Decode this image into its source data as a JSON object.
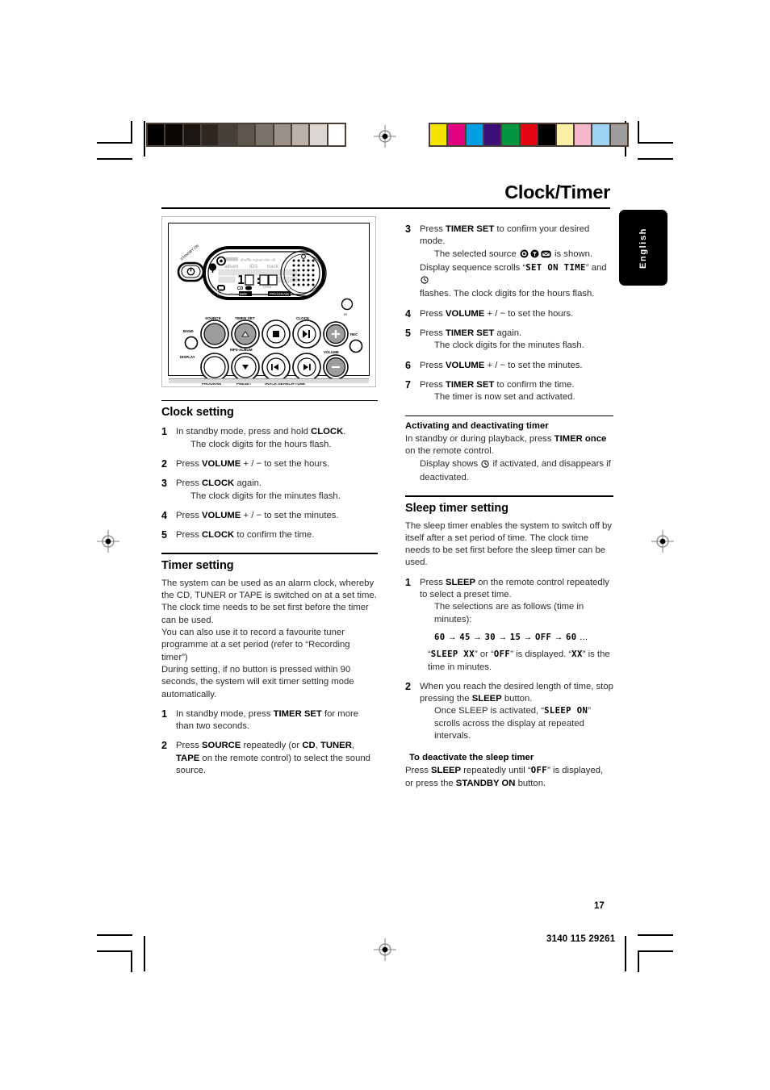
{
  "header": {
    "title": "Clock/Timer",
    "language_tab": "English"
  },
  "footer": {
    "page_number": "17",
    "document_code": "3140 115 29261"
  },
  "calibration": {
    "grayscale_swatches": [
      "#000000",
      "#0a0705",
      "#1c1613",
      "#2e2721",
      "#46403a",
      "#5d564f",
      "#7a736c",
      "#9a918a",
      "#b9b1aa",
      "#dcd7d2",
      "#ffffff"
    ],
    "color_swatches": [
      "#f5e400",
      "#e3007f",
      "#009fe3",
      "#3b1078",
      "#009640",
      "#e30613",
      "#000000",
      "#faf0a5",
      "#f5b8cd",
      "#9ed5f2",
      "#9d9d9c"
    ]
  },
  "device_figure": {
    "standby_label": "STANDBY ON",
    "display": {
      "top_indicators": [
        "shuffle",
        "repeat",
        "disc",
        "all"
      ],
      "row_labels": [
        "album",
        "ID3",
        "track"
      ],
      "time": "10:38",
      "total_label": "total",
      "media_label": "CD",
      "genre_labels": [
        "rock",
        "pop",
        "jazz",
        "PROGRAM"
      ]
    },
    "buttons": [
      "SOURCE",
      "TIMER SET",
      "CLOCK",
      "BAND",
      "DISPLAY",
      "MP3-ALBUM",
      "PROGRAM",
      "PRESET",
      "TRACK-SEARCH-TUNE",
      "VOLUME",
      "REC",
      "IR"
    ]
  },
  "clock_setting": {
    "heading": "Clock setting",
    "steps": [
      {
        "num": "1",
        "parts": [
          {
            "t": "In standby mode, press and hold ",
            "b": false
          },
          {
            "t": "CLOCK",
            "b": true
          },
          {
            "t": ".",
            "b": false
          }
        ],
        "note": "The clock digits for the hours flash."
      },
      {
        "num": "2",
        "parts": [
          {
            "t": "Press ",
            "b": false
          },
          {
            "t": "VOLUME",
            "b": true
          },
          {
            "t": " + / −  to set the hours.",
            "b": false
          }
        ],
        "note": ""
      },
      {
        "num": "3",
        "parts": [
          {
            "t": "Press ",
            "b": false
          },
          {
            "t": "CLOCK",
            "b": true
          },
          {
            "t": " again.",
            "b": false
          }
        ],
        "note": "The clock digits for the minutes flash."
      },
      {
        "num": "4",
        "parts": [
          {
            "t": "Press ",
            "b": false
          },
          {
            "t": "VOLUME",
            "b": true
          },
          {
            "t": " + / −  to set the minutes.",
            "b": false
          }
        ],
        "note": ""
      },
      {
        "num": "5",
        "parts": [
          {
            "t": "Press ",
            "b": false
          },
          {
            "t": "CLOCK",
            "b": true
          },
          {
            "t": " to confirm the time.",
            "b": false
          }
        ],
        "note": ""
      }
    ]
  },
  "timer_setting": {
    "heading": "Timer setting",
    "paragraphs": [
      "The system can be used as an alarm clock, whereby the CD, TUNER or TAPE is switched on at a set time. The clock time needs to be set first before the timer can be used.",
      "You can also use it to record a favourite tuner programme at a set period (refer to “Recording timer”)",
      "During setting, if no button is pressed within 90 seconds, the system will exit timer setting mode automatically."
    ],
    "steps": [
      {
        "num": "1",
        "parts": [
          {
            "t": "In standby mode, press ",
            "b": false
          },
          {
            "t": "TIMER SET",
            "b": true
          },
          {
            "t": " for more than two seconds.",
            "b": false
          }
        ],
        "note": ""
      },
      {
        "num": "2",
        "parts": [
          {
            "t": "Press ",
            "b": false
          },
          {
            "t": "SOURCE",
            "b": true
          },
          {
            "t": " repeatedly (or ",
            "b": false
          },
          {
            "t": "CD",
            "b": true
          },
          {
            "t": ", ",
            "b": false
          },
          {
            "t": "TUNER",
            "b": true
          },
          {
            "t": ", ",
            "b": false
          },
          {
            "t": "TAPE",
            "b": true
          },
          {
            "t": " on the remote control) to select the sound source.",
            "b": false
          }
        ],
        "note": ""
      }
    ]
  },
  "timer_setting_continued": {
    "steps": [
      {
        "num": "3",
        "parts": [
          {
            "t": "Press ",
            "b": false
          },
          {
            "t": "TIMER SET",
            "b": true
          },
          {
            "t": " to confirm your desired mode.",
            "b": false
          }
        ],
        "note_prefix": "The selected source ",
        "note_icons": [
          "cd-disc-icon",
          "tuner-antenna-icon",
          "tape-cassette-icon"
        ],
        "note_suffix": " is shown.",
        "line2_a": "Display sequence scrolls “",
        "line2_lcd": "SET ON TIME",
        "line2_b": "” and ",
        "line2_icon": "timer-clock-icon",
        "line3": "flashes. The clock digits for the hours flash."
      },
      {
        "num": "4",
        "parts": [
          {
            "t": "Press ",
            "b": false
          },
          {
            "t": "VOLUME",
            "b": true
          },
          {
            "t": " + / −  to set the hours.",
            "b": false
          }
        ],
        "note": ""
      },
      {
        "num": "5",
        "parts": [
          {
            "t": "Press ",
            "b": false
          },
          {
            "t": "TIMER SET",
            "b": true
          },
          {
            "t": " again.",
            "b": false
          }
        ],
        "note": "The clock digits for the minutes flash."
      },
      {
        "num": "6",
        "parts": [
          {
            "t": "Press ",
            "b": false
          },
          {
            "t": "VOLUME",
            "b": true
          },
          {
            "t": " + / −  to set the minutes.",
            "b": false
          }
        ],
        "note": ""
      },
      {
        "num": "7",
        "parts": [
          {
            "t": "Press ",
            "b": false
          },
          {
            "t": "TIMER SET",
            "b": true
          },
          {
            "t": " to confirm the time.",
            "b": false
          }
        ],
        "note": "The timer is now set and activated."
      }
    ]
  },
  "activating": {
    "heading": "Activating and deactivating timer",
    "line1_a": "In standby or during playback, press ",
    "line1_b": "TIMER once",
    "line1_c": " on the remote control.",
    "note_a": "Display shows ",
    "note_icon": "timer-clock-icon",
    "note_b": " if activated, and disappears if deactivated."
  },
  "sleep_timer": {
    "heading": "Sleep timer setting",
    "intro": "The sleep timer enables the system to switch off by itself after a set period of time. The clock time needs to be set first before the sleep timer can be used.",
    "step1": {
      "num": "1",
      "a": "Press ",
      "b": "SLEEP",
      "c": " on the remote control repeatedly to select a preset time.",
      "note": "The selections are as follows (time in minutes):",
      "sequence": [
        "60",
        "45",
        "30",
        "15",
        "OFF",
        "60"
      ],
      "sequence_arrow": "→",
      "sequence_tail": "…",
      "display_line": {
        "q1": "“",
        "lcd1": "SLEEP XX",
        "q2": "” or “",
        "lcd2": "OFF",
        "q3": "” is displayed. “",
        "lcd3": "XX",
        "q4": "” is the time in minutes."
      }
    },
    "step2": {
      "num": "2",
      "a": "When you reach the desired length of time, stop pressing the ",
      "b": "SLEEP",
      "c": " button.",
      "note_a": "Once SLEEP is activated, “",
      "note_lcd": "SLEEP ON",
      "note_b": "” scrolls across the display at repeated intervals."
    },
    "deactivate": {
      "heading": "To deactivate the sleep timer",
      "a": "Press ",
      "b": "SLEEP",
      "c": " repeatedly until “",
      "lcd": "OFF",
      "d": "” is displayed, or press the ",
      "e": "STANDBY ON",
      "f": " button."
    }
  }
}
